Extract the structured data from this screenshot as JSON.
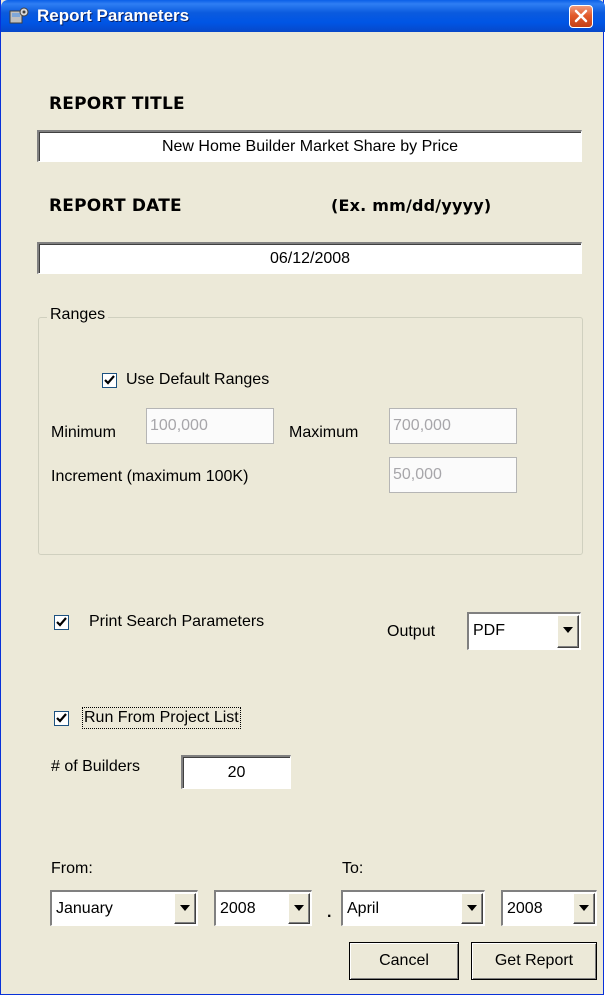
{
  "window": {
    "title": "Report Parameters"
  },
  "report_title": {
    "label": "REPORT TITLE",
    "value": "New Home Builder Market Share by Price"
  },
  "report_date": {
    "label": "REPORT DATE",
    "hint": "(Ex. mm/dd/yyyy)",
    "value": "06/12/2008"
  },
  "ranges": {
    "legend": "Ranges",
    "use_default_label": "Use Default Ranges",
    "use_default_checked": true,
    "minimum_label": "Minimum",
    "minimum_value": "100,000",
    "maximum_label": "Maximum",
    "maximum_value": "700,000",
    "increment_label": "Increment (maximum 100K)",
    "increment_value": "50,000"
  },
  "print_search": {
    "label": "Print Search Parameters",
    "checked": true
  },
  "output": {
    "label": "Output",
    "value": "PDF"
  },
  "run_from_project": {
    "label": "Run From Project List",
    "checked": true
  },
  "builders": {
    "label": "# of Builders",
    "value": "20"
  },
  "period": {
    "from_label": "From:",
    "to_label": "To:",
    "from_month": "January",
    "from_year": "2008",
    "separator": ".",
    "to_month": "April",
    "to_year": "2008"
  },
  "buttons": {
    "cancel": "Cancel",
    "get_report": "Get Report"
  },
  "colors": {
    "titlebar": "#0055e5",
    "close": "#e25b2c",
    "face": "#ece9d8"
  }
}
